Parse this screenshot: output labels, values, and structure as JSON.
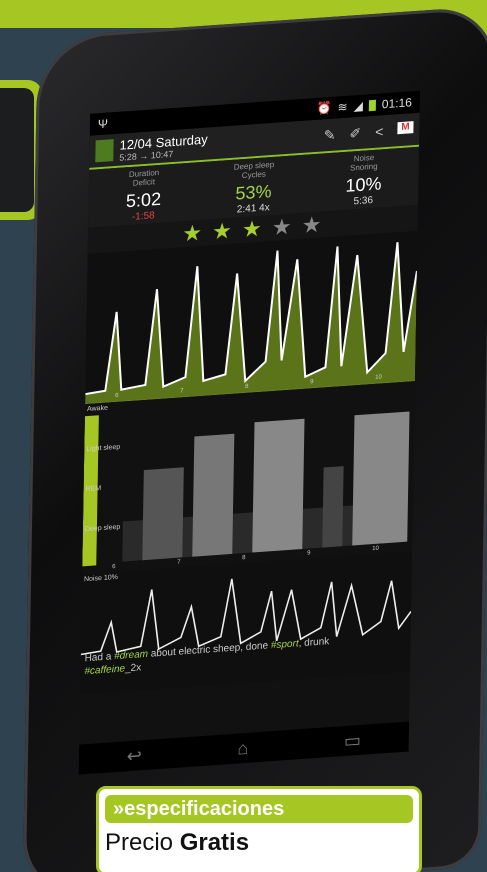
{
  "status": {
    "time": "01:16"
  },
  "header": {
    "date": "12/04 Saturday",
    "range": "5:28 → 10:47"
  },
  "stats": [
    {
      "label1": "Duration",
      "label2": "Deficit",
      "value": "5:02",
      "sub": "-1:58"
    },
    {
      "label1": "Deep sleep",
      "label2": "Cycles",
      "value": "53%",
      "sub": "2:41 4x"
    },
    {
      "label1": "Noise",
      "label2": "Snoring",
      "value": "10%",
      "sub": "5:36"
    }
  ],
  "rating": {
    "stars_on": 2.5,
    "stars_total": 5
  },
  "graph": {
    "ticks": [
      "6",
      "7",
      "8",
      "9",
      "10"
    ]
  },
  "cycles": {
    "labels": {
      "awake": "Awake",
      "light": "Light sleep",
      "rem": "REM",
      "deep": "Deep sleep"
    },
    "ticks": [
      "6",
      "7",
      "8",
      "9",
      "10"
    ]
  },
  "noise": {
    "label": "Noise 10%",
    "note_parts": [
      "Had a ",
      "#dream",
      " about electric sheep, done ",
      "#sport",
      ", drunk ",
      "#caffeine",
      "_2x"
    ]
  },
  "spec": {
    "heading": "»especificaciones",
    "price_label": "Precio ",
    "price_value": "Gratis"
  },
  "colors": {
    "accent": "#a6c723",
    "background": "#2e4250"
  }
}
